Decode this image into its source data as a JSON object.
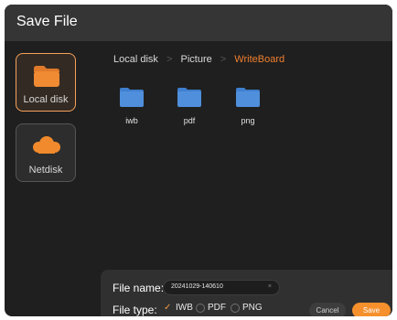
{
  "dialog": {
    "title": "Save File"
  },
  "sidebar": {
    "items": [
      {
        "label": "Local disk",
        "icon": "folder-icon"
      },
      {
        "label": "Netdisk",
        "icon": "cloud-icon"
      }
    ]
  },
  "breadcrumb": {
    "items": [
      "Local disk",
      "Picture"
    ],
    "current": "WriteBoard"
  },
  "folders": [
    {
      "name": "iwb"
    },
    {
      "name": "pdf"
    },
    {
      "name": "png"
    }
  ],
  "form": {
    "filename_label": "File name:",
    "filename_value": "20241029-140610",
    "clear_icon": "×",
    "filetype_label": "File type:",
    "filetypes": [
      {
        "label": "IWB",
        "selected": true
      },
      {
        "label": "PDF",
        "selected": false
      },
      {
        "label": "PNG",
        "selected": false
      }
    ]
  },
  "buttons": {
    "cancel": "Cancel",
    "save": "Save"
  },
  "colors": {
    "accent": "#f5902c",
    "folder": "#4f8fdc",
    "background": "#1f1f1f",
    "titlebar": "#353535"
  }
}
